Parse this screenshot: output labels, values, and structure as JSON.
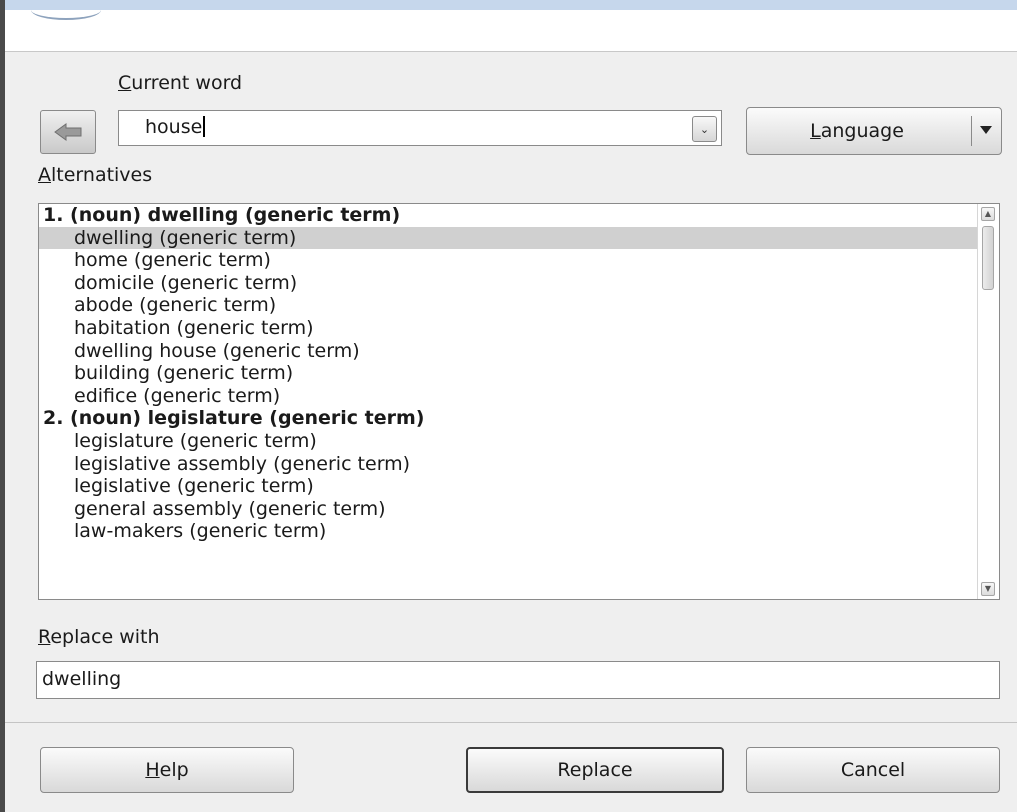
{
  "dialog": {
    "current_word_label": {
      "mnemonic": "C",
      "rest": "urrent word"
    },
    "current_word_value": "house",
    "language_label": {
      "pre": "",
      "mnemonic": "L",
      "rest": "anguage"
    },
    "alternatives_label": {
      "mnemonic": "A",
      "rest": "lternatives"
    },
    "alternatives": [
      {
        "text": "1. (noun) dwelling (generic term)",
        "kind": "head"
      },
      {
        "text": "dwelling (generic term)",
        "kind": "item",
        "selected": true
      },
      {
        "text": "home (generic term)",
        "kind": "item"
      },
      {
        "text": "domicile (generic term)",
        "kind": "item"
      },
      {
        "text": "abode (generic term)",
        "kind": "item"
      },
      {
        "text": "habitation (generic term)",
        "kind": "item"
      },
      {
        "text": "dwelling house (generic term)",
        "kind": "item"
      },
      {
        "text": "building (generic term)",
        "kind": "item"
      },
      {
        "text": "edifice (generic term)",
        "kind": "item"
      },
      {
        "text": "2. (noun) legislature (generic term)",
        "kind": "head"
      },
      {
        "text": "legislature (generic term)",
        "kind": "item"
      },
      {
        "text": "legislative assembly (generic term)",
        "kind": "item"
      },
      {
        "text": "legislative (generic term)",
        "kind": "item"
      },
      {
        "text": "general assembly (generic term)",
        "kind": "item"
      },
      {
        "text": "law-makers (generic term)",
        "kind": "item"
      }
    ],
    "replace_with_label": {
      "mnemonic": "R",
      "rest": "eplace with"
    },
    "replace_with_value": "dwelling",
    "buttons": {
      "help": {
        "mnemonic": "H",
        "rest": "elp"
      },
      "replace": "Replace",
      "cancel": "Cancel"
    },
    "icons": {
      "back": "back-arrow-icon",
      "combo_dropdown": "chevron-down-icon",
      "language_dropdown": "triangle-down-icon",
      "scroll_up": "scroll-up-icon",
      "scroll_down": "scroll-down-icon"
    }
  }
}
